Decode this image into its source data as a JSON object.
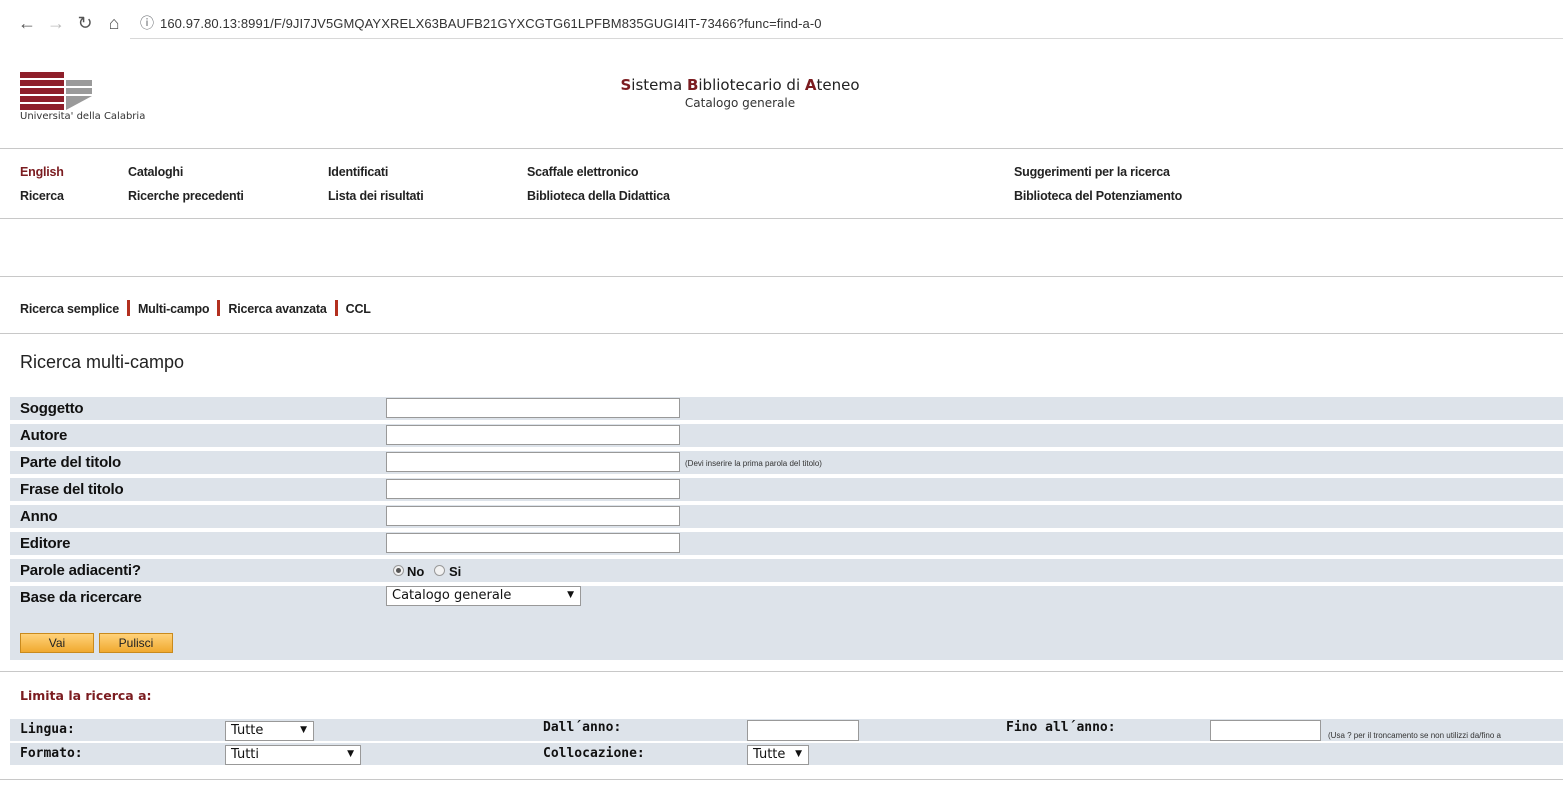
{
  "browser": {
    "url": "160.97.80.13:8991/F/9JI7JV5GMQAYXRELX63BAUFB21GYXCGTG61LPFBM835GUGI4IT-73466?func=find-a-0"
  },
  "header": {
    "university": "Universita' della Calabria",
    "title_parts": [
      "S",
      "istema ",
      "B",
      "ibliotecario di ",
      "A",
      "teneo"
    ],
    "subtitle": "Catalogo generale"
  },
  "menu": {
    "english": "English",
    "cataloghi": "Cataloghi",
    "identificati": "Identificati",
    "scaffale": "Scaffale elettronico",
    "suggerimenti": "Suggerimenti per la ricerca",
    "ricerca": "Ricerca",
    "precedenti": "Ricerche precedenti",
    "lista": "Lista dei risultati",
    "didattica": "Biblioteca della Didattica",
    "potenziamento": "Biblioteca del Potenziamento"
  },
  "tabs": {
    "semplice": "Ricerca semplice",
    "multicampo": "Multi-campo",
    "avanzata": "Ricerca avanzata",
    "ccl": "CCL"
  },
  "page_heading": "Ricerca multi-campo",
  "form": {
    "soggetto": "Soggetto",
    "autore": "Autore",
    "parte_titolo": "Parte del titolo",
    "parte_titolo_hint": "(Devi inserire la prima parola del titolo)",
    "frase_titolo": "Frase del titolo",
    "anno": "Anno",
    "editore": "Editore",
    "parole_adiacenti": "Parole adiacenti?",
    "radio_no": "No",
    "radio_si": "Si",
    "base": "Base da ricercare",
    "base_value": "Catalogo generale",
    "vai": "Vai",
    "pulisci": "Pulisci"
  },
  "limit": {
    "title": "Limita la ricerca a:",
    "lingua": "Lingua:",
    "lingua_value": "Tutte",
    "dall_anno": "Dall´anno:",
    "fino_anno": "Fino all´anno:",
    "truncation_hint": "(Usa ? per il troncamento se non utilizzi da/fino a",
    "formato": "Formato:",
    "formato_value": "Tutti",
    "collocazione": "Collocazione:",
    "collocazione_value": "Tutte"
  },
  "colors": {
    "accent": "#7b1c20",
    "row_bg": "#dde3ea",
    "button": "#f0a930"
  }
}
